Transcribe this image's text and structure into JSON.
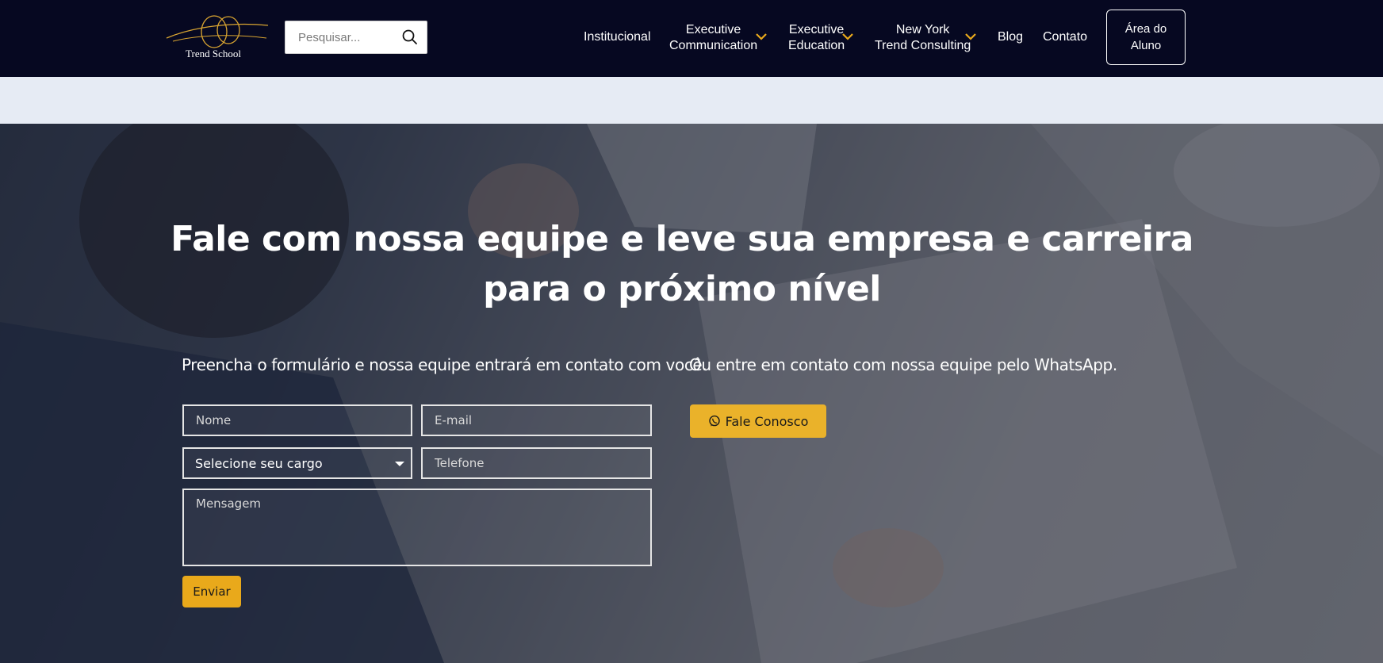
{
  "header": {
    "logo_text": "Trend School",
    "search": {
      "placeholder": "Pesquisar..."
    },
    "nav": {
      "institucional": "Institucional",
      "exec_comm_line1": "Executive",
      "exec_comm_line2": "Communication",
      "exec_edu_line1": "Executive",
      "exec_edu_line2": "Education",
      "ny_line1": "New York",
      "ny_line2": "Trend Consulting",
      "blog": "Blog",
      "contato": "Contato"
    },
    "aluno_button": "Área do Aluno"
  },
  "hero": {
    "headline": "Fale com nossa equipe e leve sua empresa e carreira para o próximo nível",
    "form_intro": "Preencha o formulário e nossa equipe entrará em contato com você.",
    "whatsapp_intro": "Ou entre em contato com nossa equipe pelo WhatsApp.",
    "form": {
      "nome_placeholder": "Nome",
      "email_placeholder": "E-mail",
      "cargo_selected": "Selecione seu cargo",
      "telefone_placeholder": "Telefone",
      "mensagem_placeholder": "Mensagem",
      "submit_label": "Enviar"
    },
    "whatsapp_button": "Fale Conosco"
  },
  "colors": {
    "header_bg": "#060821",
    "accent": "#e9a91b",
    "band": "#e6ebf4"
  },
  "icons": [
    "search-icon",
    "chevron-down-icon",
    "whatsapp-icon"
  ]
}
